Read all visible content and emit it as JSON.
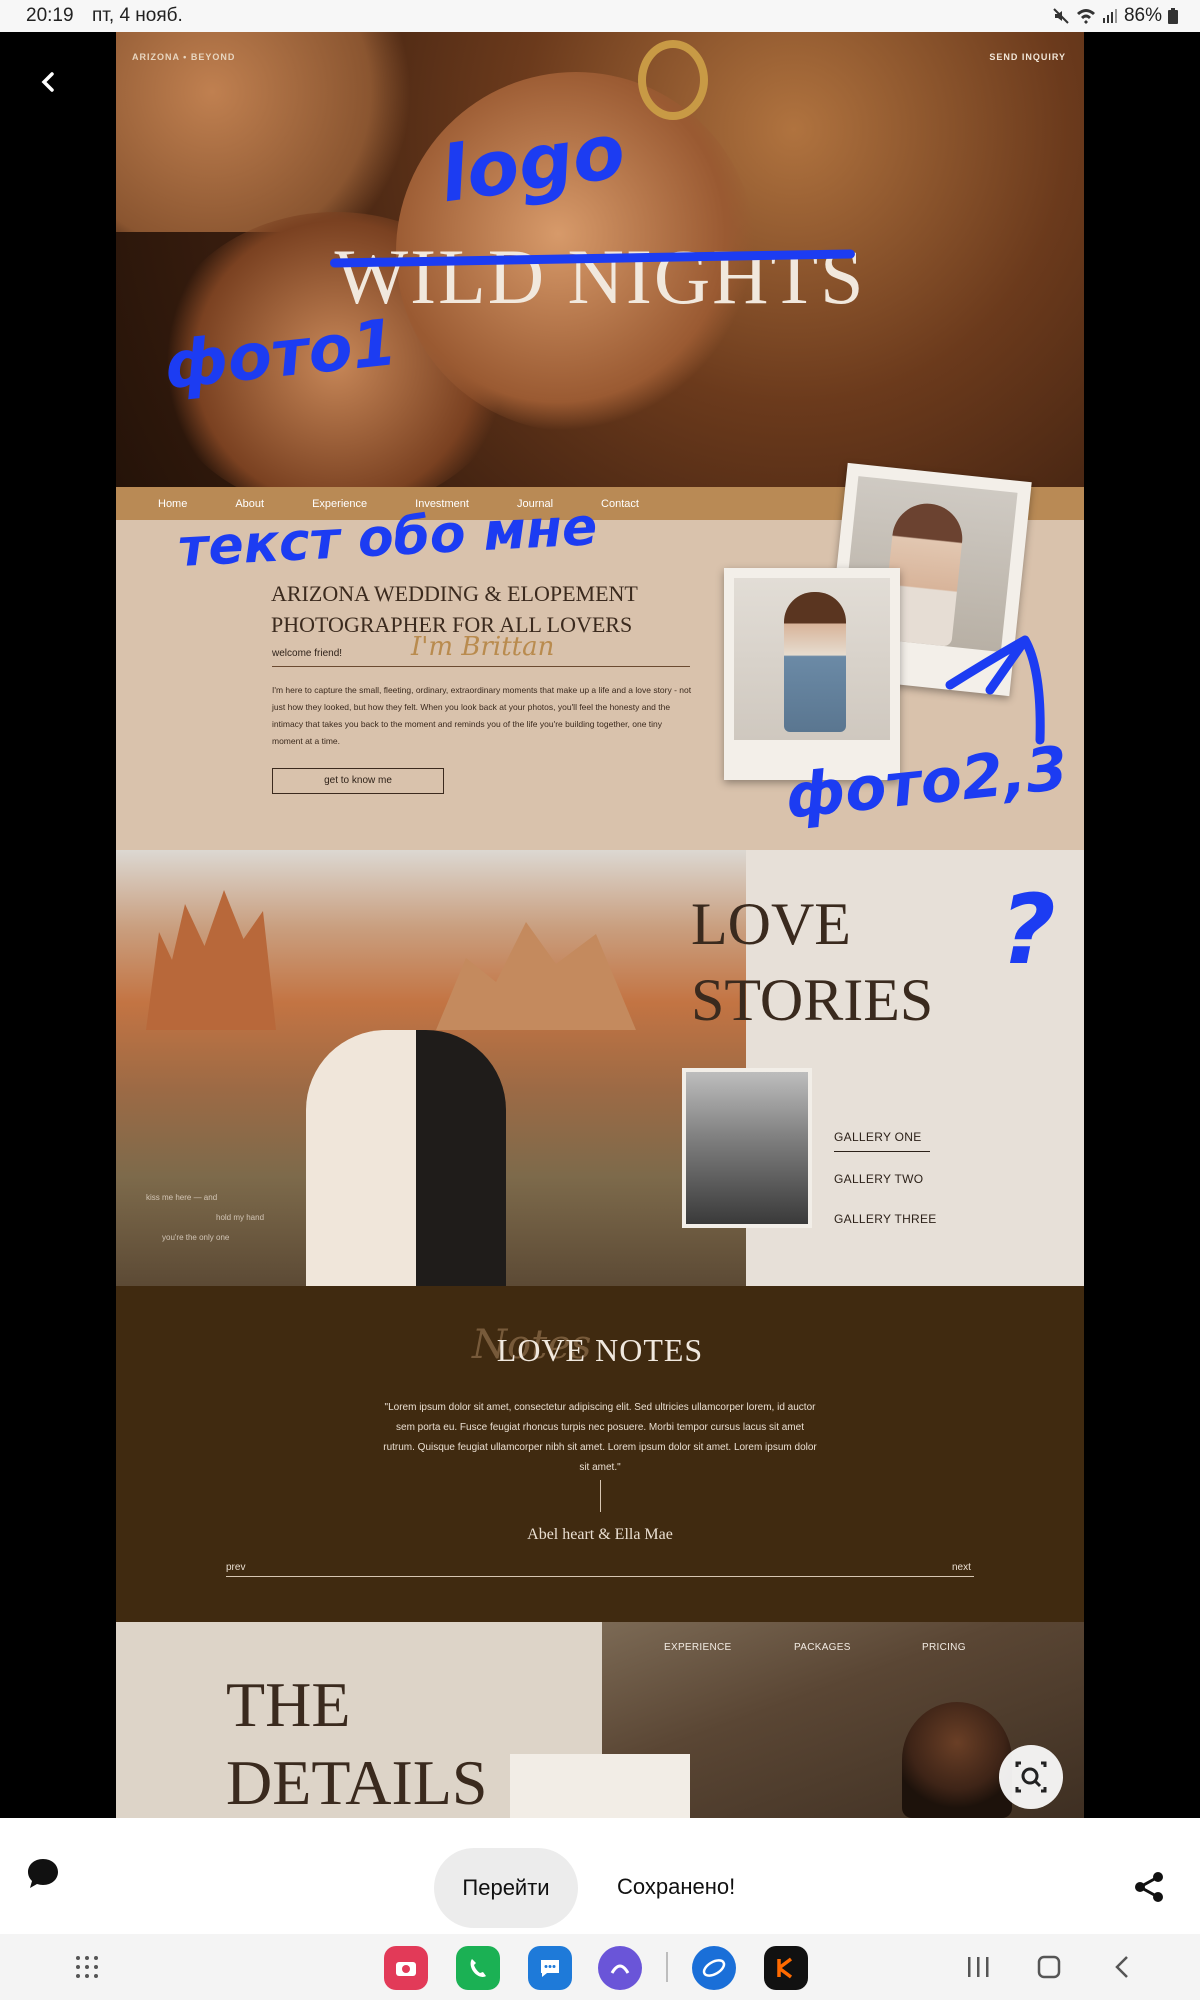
{
  "status_bar": {
    "time": "20:19",
    "date": "пт, 4 нояб.",
    "battery": "86%"
  },
  "site": {
    "brand_small": "ARIZONA • BEYOND",
    "send_inquiry": "SEND INQUIRY",
    "hero_title": "WILD NIGHTS",
    "nav": [
      "Home",
      "About",
      "Experience",
      "Investment",
      "Journal",
      "Contact"
    ],
    "about": {
      "title": "ARIZONA WEDDING & ELOPEMENT PHOTOGRAPHER FOR ALL LOVERS",
      "welcome": "welcome friend!",
      "signature": "I'm Brittan",
      "body": "I'm here to capture the small, fleeting, ordinary, extraordinary moments that make up a life and a love story - not just how they looked, but how they felt. When you look back at your photos, you'll feel the honesty and the intimacy that takes you back to the moment and reminds you of the life you're building together, one tiny moment at a time.",
      "button": "get to know me"
    },
    "stories": {
      "title_line1": "LOVE",
      "title_line2": "STORIES",
      "galleries": [
        "GALLERY ONE",
        "GALLERY TWO",
        "GALLERY THREE"
      ],
      "photo_text": [
        "kiss me here — and",
        "hold my hand",
        "you're the only one"
      ]
    },
    "notes": {
      "title": "LOVE NOTES",
      "script": "Notes",
      "quote": "\"Lorem ipsum dolor sit amet, consectetur adipiscing elit. Sed ultricies ullamcorper lorem, id auctor sem porta eu. Fusce feugiat rhoncus turpis nec posuere. Morbi tempor cursus lacus sit amet rutrum. Quisque feugiat ullamcorper nibh sit amet. Lorem ipsum dolor sit amet. Lorem ipsum dolor sit amet.\"",
      "author": "Abel heart & Ella Mae",
      "prev": "prev",
      "next": "next"
    },
    "details": {
      "title_line1": "THE",
      "title_line2": "DETAILS",
      "nav": [
        "EXPERIENCE",
        "PACKAGES",
        "PRICING"
      ]
    }
  },
  "annotations": {
    "logo": "logo",
    "photo1": "фото1",
    "about_me": "текст обо мне",
    "photo23": "фото2,3",
    "question": "?"
  },
  "viewer": {
    "goto_label": "Перейти",
    "saved_label": "Сохранено!"
  },
  "colors": {
    "annotation": "#1c3cf2",
    "nav_strip": "#b98a55",
    "notes_bg": "#402a10"
  }
}
